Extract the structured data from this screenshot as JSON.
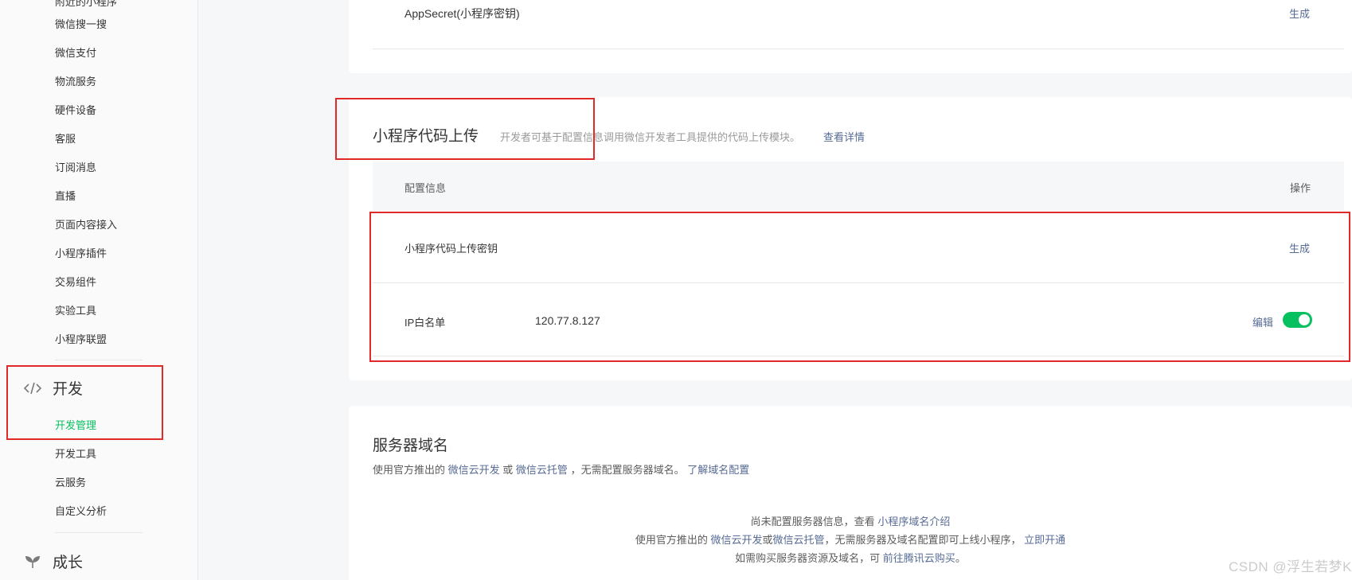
{
  "sidebar": {
    "cut_item": "附近的小程序",
    "items": [
      {
        "label": "微信搜一搜"
      },
      {
        "label": "微信支付"
      },
      {
        "label": "物流服务"
      },
      {
        "label": "硬件设备"
      },
      {
        "label": "客服"
      },
      {
        "label": "订阅消息"
      },
      {
        "label": "直播"
      },
      {
        "label": "页面内容接入"
      },
      {
        "label": "小程序插件"
      },
      {
        "label": "交易组件"
      },
      {
        "label": "实验工具"
      },
      {
        "label": "小程序联盟"
      }
    ],
    "dev_group": {
      "title": "开发",
      "icon": "code-icon",
      "items": [
        {
          "label": "开发管理",
          "active": true
        },
        {
          "label": "开发工具"
        },
        {
          "label": "云服务"
        },
        {
          "label": "自定义分析"
        }
      ]
    },
    "growth_group": {
      "title": "成长",
      "icon": "sprout-icon"
    }
  },
  "appsecret": {
    "label": "AppSecret(小程序密钥)",
    "action": "生成"
  },
  "upload": {
    "title": "小程序代码上传",
    "desc": "开发者可基于配置信息调用微信开发者工具提供的代码上传模块。",
    "desc_link": "查看详情",
    "col_config": "配置信息",
    "col_action": "操作",
    "key_row": {
      "label": "小程序代码上传密钥",
      "action": "生成"
    },
    "ip_row": {
      "label": "IP白名单",
      "value": "120.77.8.127",
      "action": "编辑",
      "toggle_on": true
    }
  },
  "server": {
    "title": "服务器域名",
    "desc_prefix": "使用官方推出的",
    "link_cloud_dev": "微信云开发",
    "or": "或",
    "link_cloud_host": "微信云托管",
    "desc_suffix": "，无需配置服务器域名。",
    "link_domain_cfg": "了解域名配置",
    "line1_prefix": "尚未配置服务器信息，查看",
    "line1_link": "小程序域名介绍",
    "line2_prefix": "使用官方推出的",
    "line2_link1": "微信云开发",
    "line2_or": "或",
    "line2_link2": "微信云托管",
    "line2_mid": "，无需服务器及域名配置即可上线小程序，",
    "line2_link3": "立即开通",
    "line3_prefix": "如需购买服务器资源及域名，可",
    "line3_link": "前往腾讯云购买",
    "line3_suffix": "。"
  },
  "watermark": "CSDN @浮生若梦K",
  "colors": {
    "accent": "#07c160",
    "link": "#576b95",
    "highlight": "#e02a2a"
  }
}
